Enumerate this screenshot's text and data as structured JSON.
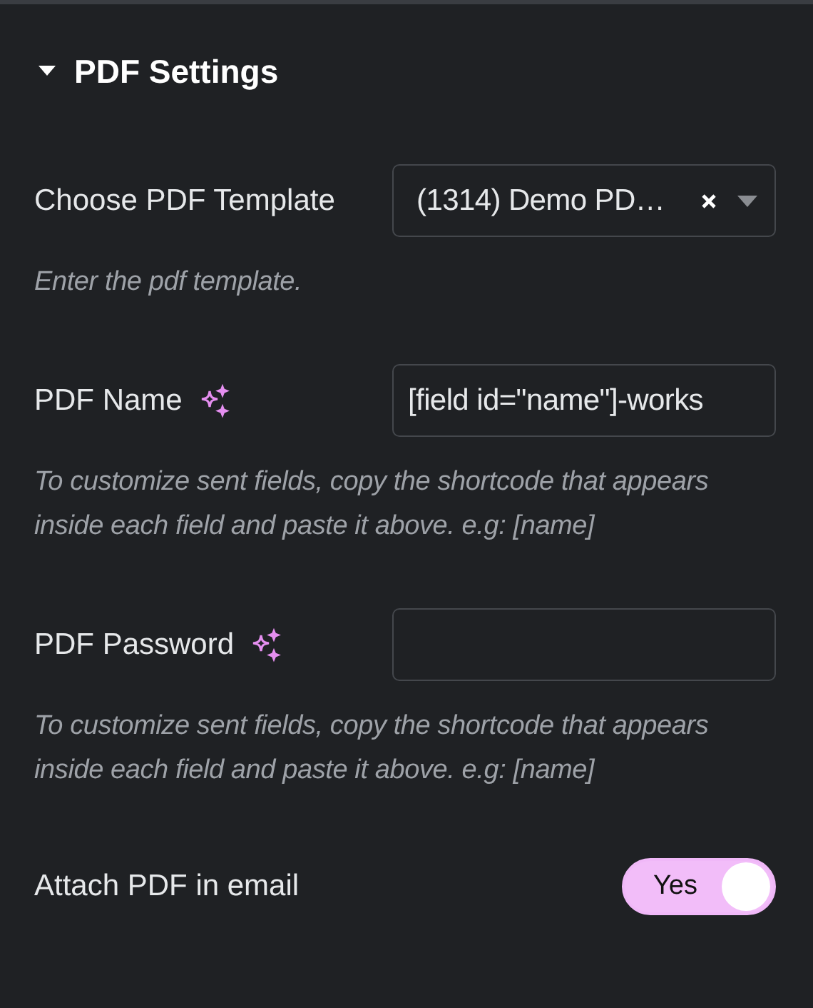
{
  "section": {
    "title": "PDF Settings",
    "expanded": true
  },
  "controls": [
    {
      "kind": "select",
      "label": "Choose PDF Template",
      "value": "(1314) Demo PD…",
      "clearable": true,
      "description": "Enter the pdf template."
    },
    {
      "kind": "text",
      "label": "PDF Name",
      "ai": true,
      "value": "[field id=\"name\"]-works",
      "description": "To customize sent fields, copy the shortcode that appears inside each field and paste it above. e.g: [name]"
    },
    {
      "kind": "text",
      "label": "PDF Password",
      "ai": true,
      "description": "To customize sent fields, copy the shortcode that appears inside each field and paste it above. e.g: [name]"
    },
    {
      "kind": "toggle",
      "label": "Attach PDF in email",
      "on": true,
      "on_label": "Yes"
    }
  ]
}
